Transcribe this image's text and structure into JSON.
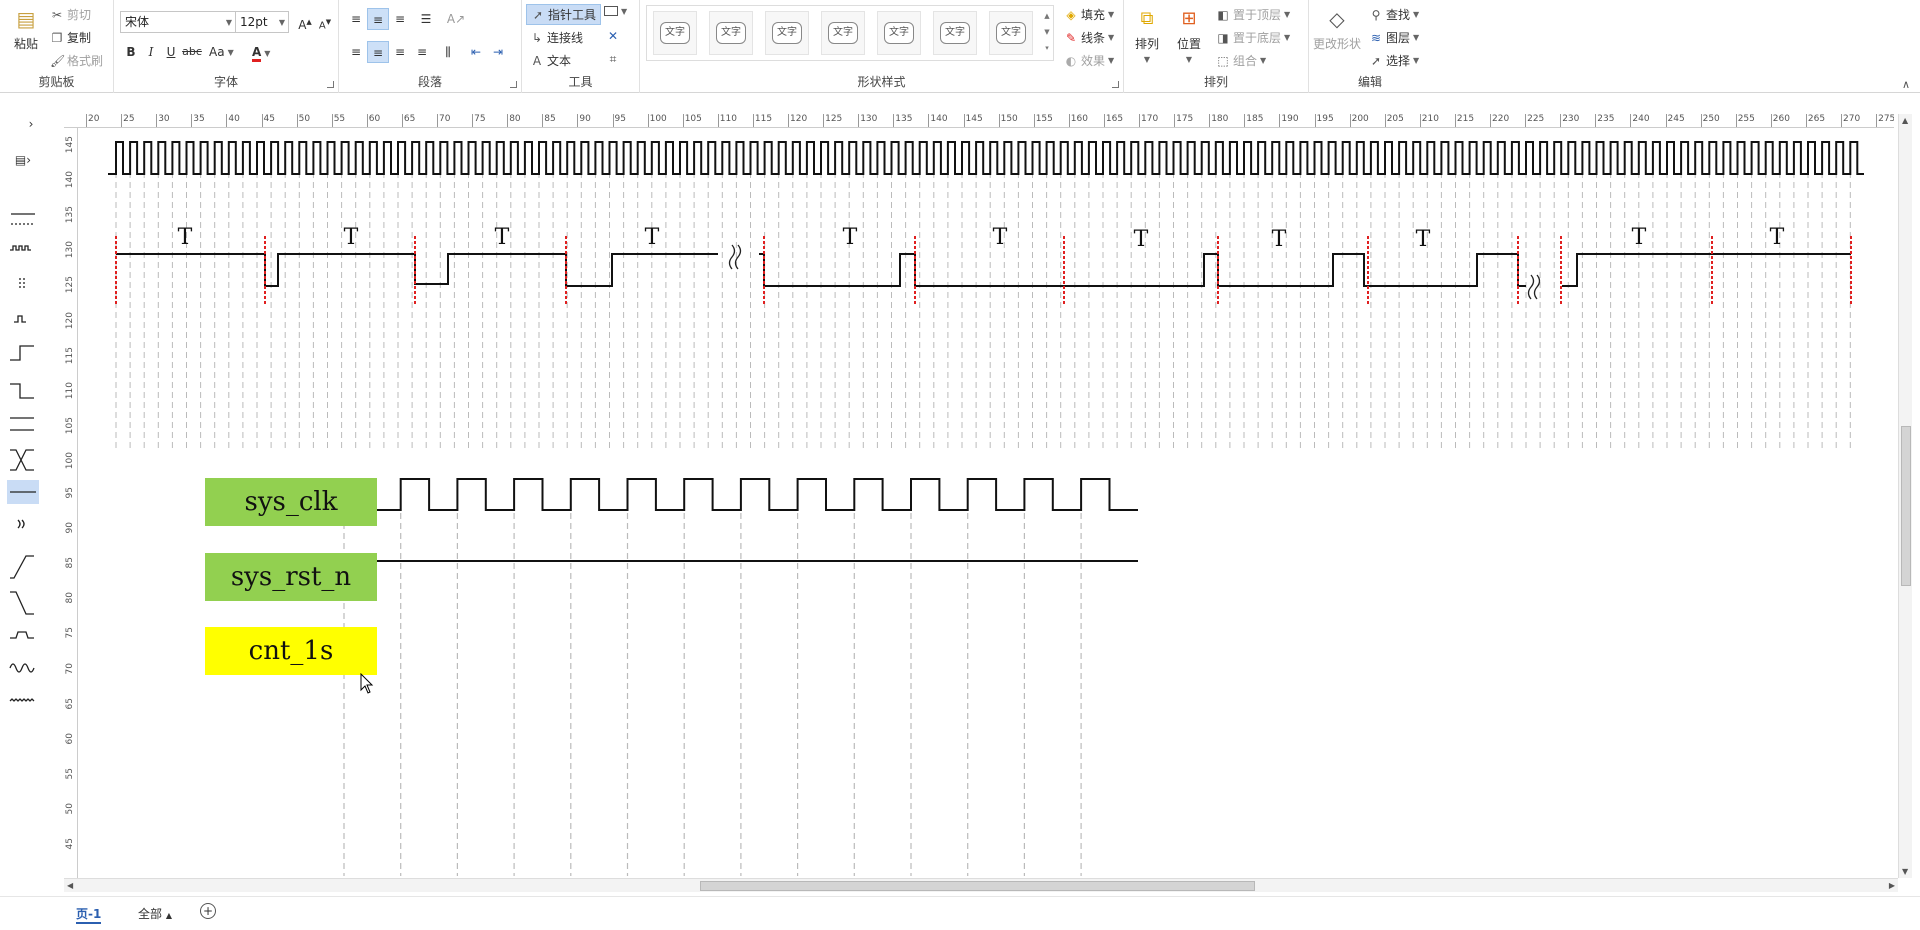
{
  "ribbon": {
    "clipboard": {
      "label": "剪贴板",
      "paste": "粘贴",
      "cut": "剪切",
      "copy": "复制",
      "format_painter": "格式刷"
    },
    "font": {
      "label": "字体",
      "family": "宋体",
      "size": "12pt",
      "bold": "B",
      "italic": "I",
      "underline": "U",
      "strike": "abc",
      "case": "Aa",
      "color": "A"
    },
    "paragraph": {
      "label": "段落"
    },
    "tools": {
      "label": "工具",
      "pointer": "指针工具",
      "connector": "连接线",
      "text": "文本"
    },
    "shape_styles": {
      "label": "形状样式",
      "swatch_text": "文字",
      "fill": "填充",
      "line": "线条",
      "effect": "效果"
    },
    "arrange": {
      "label": "排列",
      "arrange": "排列",
      "position": "位置",
      "bring_front": "置于顶层",
      "send_back": "置于底层",
      "group": "组合"
    },
    "edit": {
      "label": "编辑",
      "change_shape": "更改形状",
      "find": "查找",
      "layers": "图层",
      "select": "选择"
    }
  },
  "ruler": {
    "h_ticks": [
      "20",
      "25",
      "30",
      "35",
      "40",
      "45",
      "50",
      "55",
      "60",
      "65",
      "70",
      "75",
      "80",
      "85",
      "90",
      "95",
      "100",
      "105",
      "110",
      "115",
      "120",
      "125",
      "130",
      "135",
      "140",
      "145",
      "150",
      "155",
      "160",
      "165",
      "170",
      "175",
      "180",
      "185",
      "190",
      "195",
      "200",
      "205",
      "210",
      "215",
      "220",
      "225",
      "230",
      "235",
      "240",
      "245",
      "250",
      "255",
      "260",
      "265",
      "270",
      "275"
    ],
    "v_ticks": [
      "145",
      "140",
      "135",
      "130",
      "125",
      "120",
      "115",
      "110",
      "105",
      "100",
      "95",
      "90",
      "85",
      "80",
      "75",
      "70",
      "65",
      "60",
      "55",
      "50",
      "45"
    ]
  },
  "diagram": {
    "period_label": "T",
    "signals": {
      "clk": "sys_clk",
      "rst": "sys_rst_n",
      "cnt": "cnt_1s"
    },
    "colors": {
      "green": "#92d050",
      "yellow": "#ffff00",
      "marker": "#e02020"
    }
  },
  "status": {
    "page": "页-1",
    "all": "全部",
    "add": "+"
  }
}
